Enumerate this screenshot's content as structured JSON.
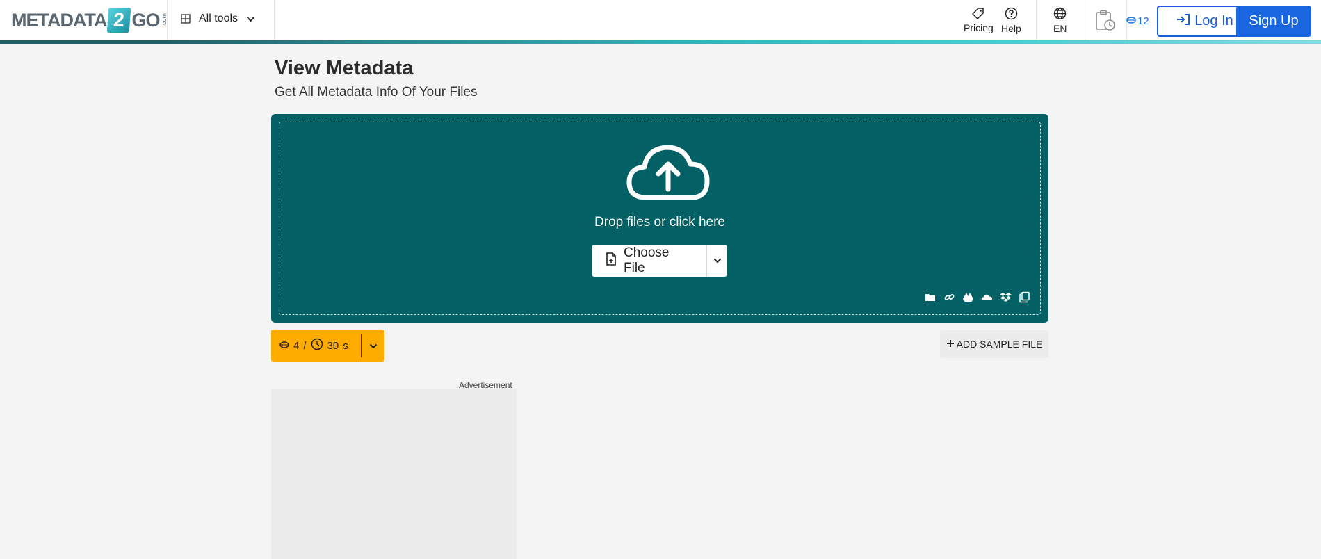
{
  "header": {
    "logo": {
      "part1": "METADATA",
      "digit": "2",
      "part2": "GO",
      "suffix": ".com"
    },
    "all_tools_label": "All tools",
    "pricing_label": "Pricing",
    "help_label": "Help",
    "language_label": "EN",
    "credits_count": "12",
    "login_label": "Log In",
    "signup_label": "Sign Up"
  },
  "page": {
    "title": "View Metadata",
    "subtitle": "Get All Metadata Info Of Your Files"
  },
  "upload": {
    "drop_text": "Drop files or click here",
    "choose_label": "Choose File",
    "sources": [
      "folder-icon",
      "link-icon",
      "google-drive-icon",
      "onedrive-icon",
      "dropbox-icon",
      "clipboard-icon"
    ]
  },
  "usage": {
    "credits": "4",
    "separator": "/",
    "time_value": "30",
    "time_unit": "s"
  },
  "sample": {
    "label": "ADD SAMPLE FILE"
  },
  "ad": {
    "label": "Advertisement"
  },
  "colors": {
    "upload_bg": "#036165",
    "usage_bg": "#ffab00",
    "primary_blue": "#1a66e0"
  }
}
